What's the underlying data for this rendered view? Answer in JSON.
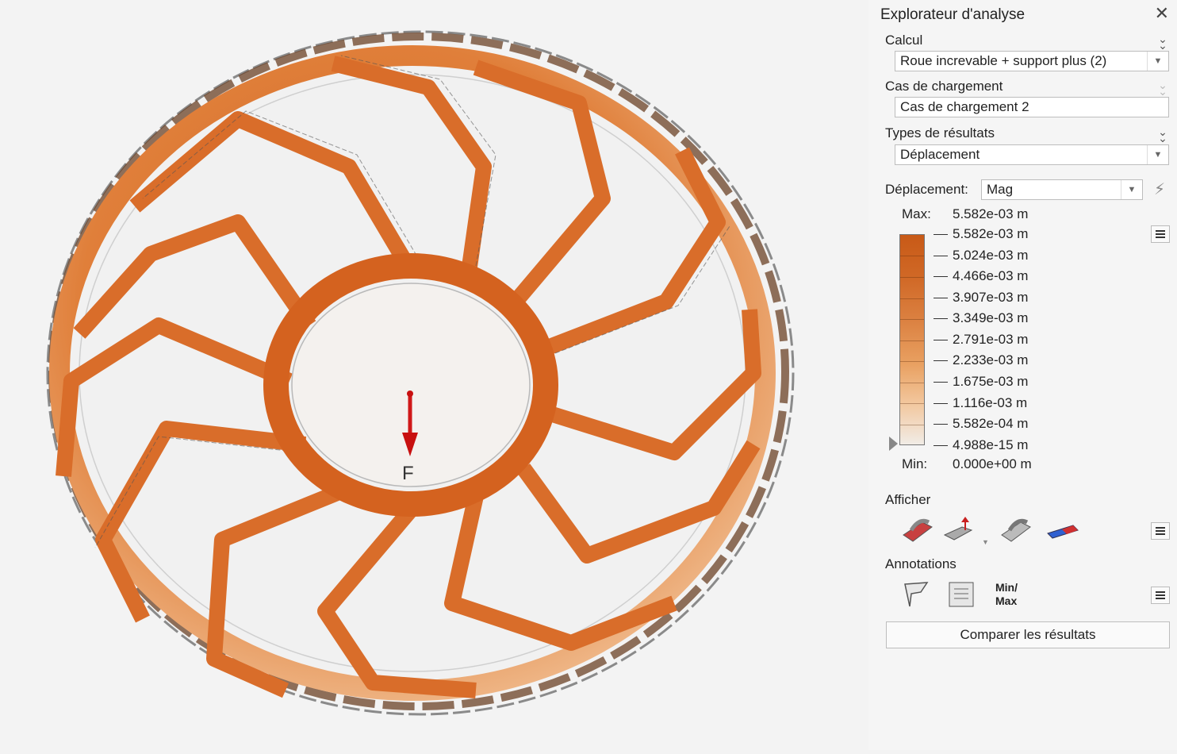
{
  "viewport": {
    "load_label": "F"
  },
  "panel": {
    "title": "Explorateur d'analyse",
    "calcul": {
      "label": "Calcul",
      "value": "Roue increvable + support plus (2)"
    },
    "cas": {
      "label": "Cas de chargement",
      "value": "Cas de chargement 2"
    },
    "types": {
      "label": "Types de résultats",
      "value": "Déplacement"
    },
    "deplacement": {
      "label": "Déplacement:",
      "value": "Mag"
    },
    "legend": {
      "max_label": "Max:",
      "max_value": "5.582e-03 m",
      "min_label": "Min:",
      "min_value": "0.000e+00 m",
      "ticks": [
        "5.582e-03 m",
        "5.024e-03 m",
        "4.466e-03 m",
        "3.907e-03 m",
        "3.349e-03 m",
        "2.791e-03 m",
        "2.233e-03 m",
        "1.675e-03 m",
        "1.116e-03 m",
        "5.582e-04 m",
        "4.988e-15 m"
      ],
      "colors": {
        "high": "#c85a17",
        "mid": "#e9a162",
        "low": "#f1ece6"
      }
    },
    "afficher": {
      "label": "Afficher"
    },
    "annotations": {
      "label": "Annotations",
      "minmax_line1": "Min/",
      "minmax_line2": "Max"
    },
    "compare_button": "Comparer les résultats"
  }
}
